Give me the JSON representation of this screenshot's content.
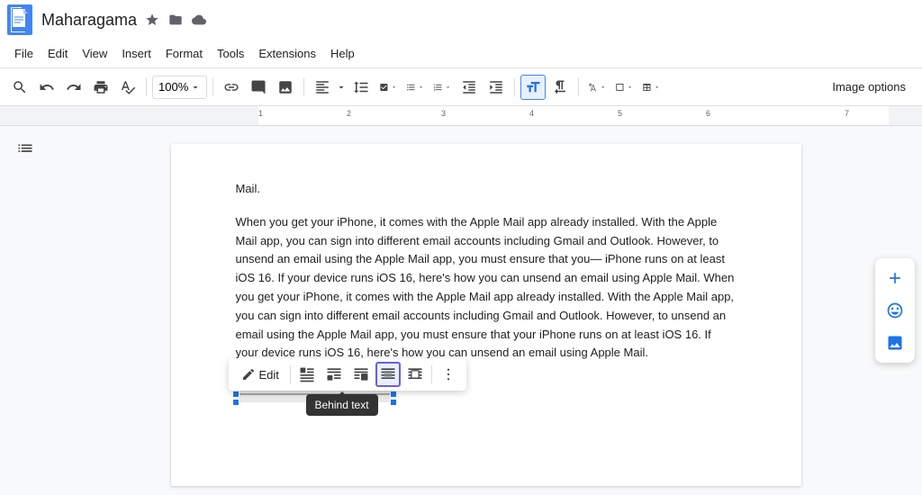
{
  "title": "Maharagama",
  "title_icons": [
    "star",
    "folder",
    "cloud"
  ],
  "menu": {
    "items": [
      "File",
      "Edit",
      "View",
      "Insert",
      "Format",
      "Tools",
      "Extensions",
      "Help"
    ]
  },
  "toolbar": {
    "zoom": "100%",
    "image_options": "Image options"
  },
  "document": {
    "paragraph1": "Mail.",
    "paragraph2": "When you get your iPhone, it comes with the Apple Mail app already installed. With the Apple Mail app, you can sign into different email accounts including Gmail and Outlook. However, to unsend an email using the Apple Mail app, you must ensure that you— iPhone runs on at least iOS 16. If your device runs iOS 16, here's how you can unsend an email using Apple Mail. When you get your iPhone, it comes with the Apple Mail app already installed. With the Apple Mail app, you can sign into different email accounts including Gmail and Outlook. However, to unsend an email using the Apple Mail app, you must ensure that your iPhone runs on at least iOS 16. If your device runs iOS 16, here's how you can unsend an email using Apple Mail."
  },
  "float_toolbar": {
    "edit_label": "Edit",
    "tooltip": "Behind text"
  },
  "right_buttons": {
    "btn1": "+",
    "btn2": "☺",
    "btn3": "🖼"
  }
}
